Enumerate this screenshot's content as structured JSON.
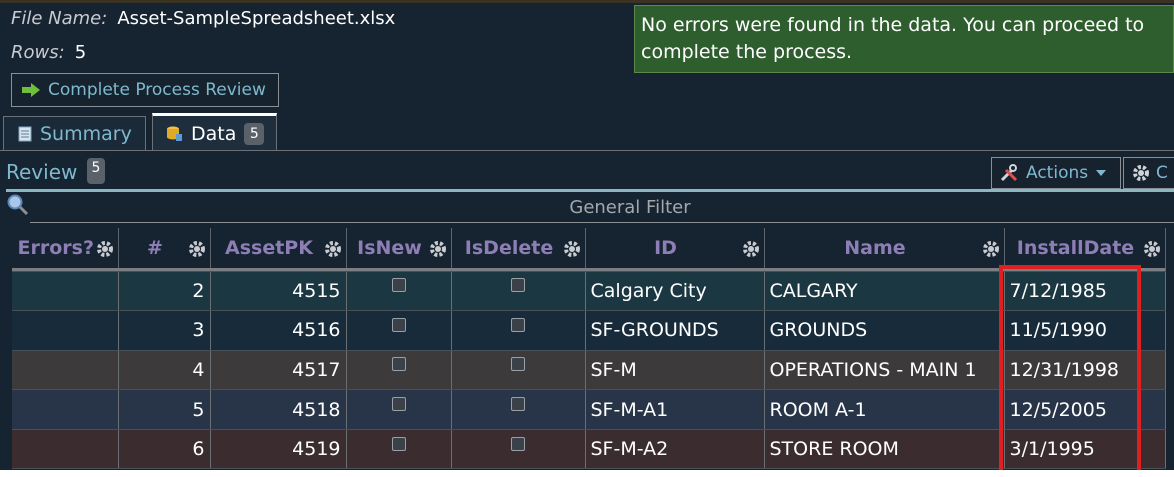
{
  "file": {
    "name_label": "File Name:",
    "name_value": "Asset-SampleSpreadsheet.xlsx",
    "rows_label": "Rows:",
    "rows_value": "5"
  },
  "complete_button": {
    "label": "Complete Process Review",
    "icon": "arrow-right-icon"
  },
  "message": "No errors were found in the data. You can proceed to complete the process.",
  "tabs": [
    {
      "label": "Summary",
      "icon": "document-icon"
    },
    {
      "label": "Data",
      "icon": "database-icon",
      "badge": "5"
    }
  ],
  "review": {
    "label": "Review",
    "badge": "5"
  },
  "actions": {
    "label": "Actions",
    "icon": "tools-icon"
  },
  "config": {
    "label": "C",
    "icon": "gear-icon"
  },
  "filter": {
    "label": "General Filter",
    "icon": "search-icon"
  },
  "table": {
    "columns": [
      "Errors?",
      "#",
      "AssetPK",
      "IsNew",
      "IsDelete",
      "ID",
      "Name",
      "InstallDate"
    ],
    "rows": [
      {
        "errors": "",
        "num": "2",
        "assetpk": "4515",
        "isnew": false,
        "isdelete": false,
        "id": "Calgary City",
        "name": "CALGARY",
        "installdate": "7/12/1985"
      },
      {
        "errors": "",
        "num": "3",
        "assetpk": "4516",
        "isnew": false,
        "isdelete": false,
        "id": "SF-GROUNDS",
        "name": "GROUNDS",
        "installdate": "11/5/1990"
      },
      {
        "errors": "",
        "num": "4",
        "assetpk": "4517",
        "isnew": false,
        "isdelete": false,
        "id": "SF-M",
        "name": "OPERATIONS - MAIN 1",
        "installdate": "12/31/1998"
      },
      {
        "errors": "",
        "num": "5",
        "assetpk": "4518",
        "isnew": false,
        "isdelete": false,
        "id": "SF-M-A1",
        "name": "ROOM A-1",
        "installdate": "12/5/2005"
      },
      {
        "errors": "",
        "num": "6",
        "assetpk": "4519",
        "isnew": false,
        "isdelete": false,
        "id": "SF-M-A2",
        "name": "STORE ROOM",
        "installdate": "3/1/1995"
      }
    ]
  },
  "colors": {
    "background": "#162331",
    "accent_teal": "#7fb9ce",
    "header_purple": "#8d7eb5",
    "success_green": "#2e5e2e",
    "highlight_red": "#e02020"
  }
}
